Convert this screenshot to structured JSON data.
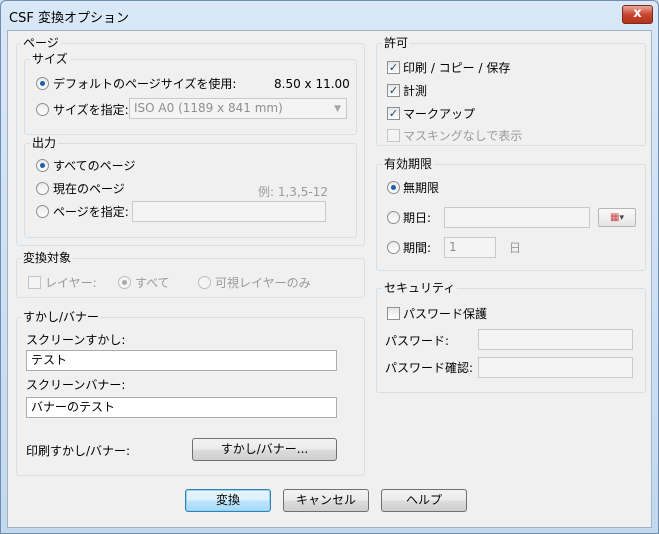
{
  "window": {
    "title": "CSF 変換オプション",
    "close_glyph": "x"
  },
  "page": {
    "legend": "ページ",
    "size": {
      "legend": "サイズ",
      "default_label": "デフォルトのページサイズを使用:",
      "default_value": "8.50 x 11.00",
      "specify_label": "サイズを指定:",
      "specify_value": "ISO A0 (1189 x 841 mm)"
    },
    "output": {
      "legend": "出力",
      "all_label": "すべてのページ",
      "current_label": "現在のページ",
      "example": "例: 1,3,5-12",
      "specify_label": "ページを指定:",
      "specify_value": ""
    }
  },
  "target": {
    "legend": "変換対象",
    "layer_label": "レイヤー:",
    "all_label": "すべて",
    "visible_label": "可視レイヤーのみ"
  },
  "watermark": {
    "legend": "すかし/バナー",
    "screen_wm_label": "スクリーンすかし:",
    "screen_wm_value": "テスト",
    "screen_banner_label": "スクリーンバナー:",
    "screen_banner_value": "バナーのテスト",
    "print_label": "印刷すかし/バナー:",
    "print_button": "すかし/バナー..."
  },
  "permission": {
    "legend": "許可",
    "print_copy_save": "印刷 / コピー / 保存",
    "measure": "計測",
    "markup": "マークアップ",
    "masking": "マスキングなしで表示",
    "checked": {
      "print_copy_save": true,
      "measure": true,
      "markup": true,
      "masking": false
    }
  },
  "expiry": {
    "legend": "有効期限",
    "unlimited": "無期限",
    "date_label": "期日:",
    "date_value": "",
    "period_label": "期間:",
    "period_value": "1",
    "period_unit": "日",
    "date_picker_glyph": "▾"
  },
  "security": {
    "legend": "セキュリティ",
    "password_protect": "パスワード保護",
    "password_label": "パスワード:",
    "confirm_label": "パスワード確認:",
    "password_value": "",
    "confirm_value": ""
  },
  "buttons": {
    "convert": "変換",
    "cancel": "キャンセル",
    "help": "ヘルプ"
  },
  "colors": {
    "accent": "#1d5fa8",
    "close": "#c8452f"
  }
}
